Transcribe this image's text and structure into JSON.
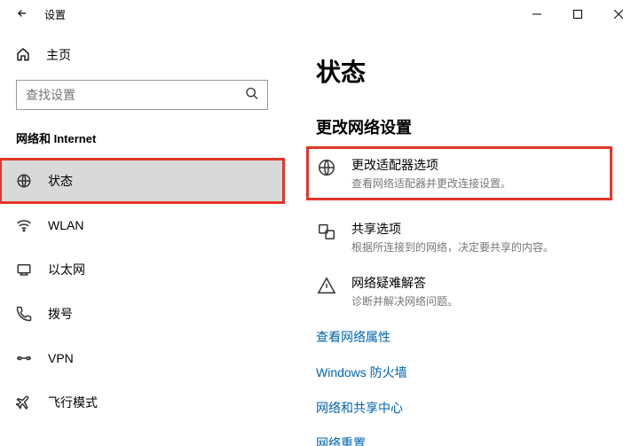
{
  "titlebar": {
    "title": "设置"
  },
  "sidebar": {
    "home": "主页",
    "search_placeholder": "查找设置",
    "section": "网络和 Internet",
    "items": [
      {
        "label": "状态"
      },
      {
        "label": "WLAN"
      },
      {
        "label": "以太网"
      },
      {
        "label": "拨号"
      },
      {
        "label": "VPN"
      },
      {
        "label": "飞行模式"
      }
    ]
  },
  "content": {
    "title": "状态",
    "subtitle": "更改网络设置",
    "options": [
      {
        "title": "更改适配器选项",
        "desc": "查看网络适配器并更改连接设置。"
      },
      {
        "title": "共享选项",
        "desc": "根据所连接到的网络，决定要共享的内容。"
      },
      {
        "title": "网络疑难解答",
        "desc": "诊断并解决网络问题。"
      }
    ],
    "links": [
      "查看网络属性",
      "Windows 防火墙",
      "网络和共享中心",
      "网络重置"
    ]
  }
}
